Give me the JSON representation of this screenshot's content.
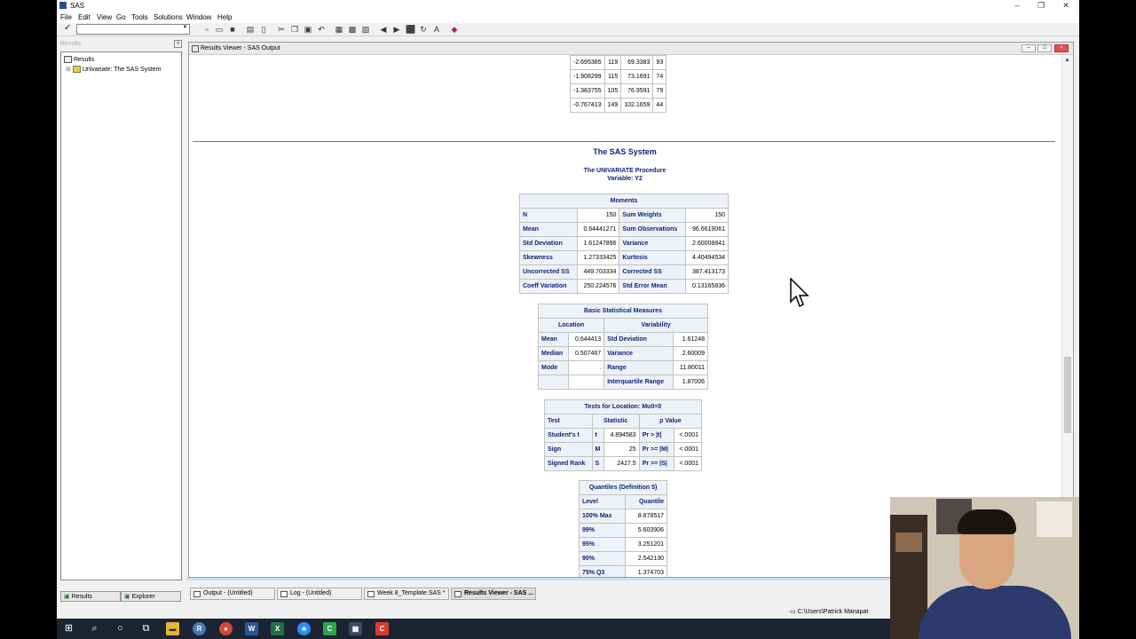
{
  "app": {
    "title": "SAS",
    "colors": {
      "header_text": "#112277",
      "header_bg": "#edf2f9"
    }
  },
  "menu": [
    "File",
    "Edit",
    "View",
    "Go",
    "Tools",
    "Solutions",
    "Window",
    "Help"
  ],
  "left_panel": {
    "header": "Results",
    "tree_root": "Results",
    "tree_child": "Univariate:  The SAS System",
    "tabs": [
      "Results",
      "Explorer"
    ]
  },
  "results_viewer": {
    "title": "Results Viewer - SAS Output"
  },
  "top_rows": [
    [
      "-2.695385",
      "119",
      "69.3383",
      "93"
    ],
    [
      "-1.908299",
      "115",
      "73.1691",
      "74"
    ],
    [
      "-1.383755",
      "105",
      "76.9591",
      "79"
    ],
    [
      "-0.767413",
      "149",
      "102.1659",
      "44"
    ]
  ],
  "report": {
    "title": "The SAS System",
    "procedure": "The UNIVARIATE Procedure",
    "variable": "Variable: Y2"
  },
  "moments": {
    "caption": "Moments",
    "rows": [
      [
        "N",
        "150",
        "Sum Weights",
        "150"
      ],
      [
        "Mean",
        "0.64441271",
        "Sum Observations",
        "96.6619061"
      ],
      [
        "Std Deviation",
        "1.61247896",
        "Variance",
        "2.60008841"
      ],
      [
        "Skewness",
        "1.27333425",
        "Kurtosis",
        "4.40494534"
      ],
      [
        "Uncorrected SS",
        "449.703334",
        "Corrected SS",
        "387.413173"
      ],
      [
        "Coeff Variation",
        "250.224576",
        "Std Error Mean",
        "0.13165836"
      ]
    ]
  },
  "basic_stats": {
    "caption": "Basic Statistical Measures",
    "location_header": "Location",
    "variability_header": "Variability",
    "rows": [
      [
        "Mean",
        "0.644413",
        "Std Deviation",
        "1.61248"
      ],
      [
        "Median",
        "0.507467",
        "Variance",
        "2.60009"
      ],
      [
        "Mode",
        ".",
        "Range",
        "11.80011"
      ],
      [
        "",
        "",
        "Interquartile Range",
        "1.87006"
      ]
    ]
  },
  "tests": {
    "caption": "Tests for Location: Mu0=0",
    "headers": [
      "Test",
      "Statistic",
      "p Value"
    ],
    "rows": [
      [
        "Student's t",
        "t",
        "4.894583",
        "Pr > |t|",
        "<.0001"
      ],
      [
        "Sign",
        "M",
        "25",
        "Pr >= |M|",
        "<.0001"
      ],
      [
        "Signed Rank",
        "S",
        "2427.5",
        "Pr >= |S|",
        "<.0001"
      ]
    ]
  },
  "quantiles": {
    "caption": "Quantiles (Definition 5)",
    "headers": [
      "Level",
      "Quantile"
    ],
    "rows": [
      [
        "100% Max",
        "8.878517"
      ],
      [
        "99%",
        "5.603906"
      ],
      [
        "95%",
        "3.251201"
      ],
      [
        "90%",
        "2.542130"
      ],
      [
        "75% Q3",
        "1.374703"
      ]
    ]
  },
  "window_tabs": [
    "Output - (Untitled)",
    "Log - (Untitled)",
    "Week 8_Template.SAS *",
    "Results Viewer - SAS ..."
  ],
  "status": {
    "path": "C:\\Users\\Patrick Manapat"
  },
  "taskbar_icons": [
    "windows-start-icon",
    "search-icon",
    "cortana-icon",
    "task-view-icon",
    "file-explorer-icon",
    "r-icon",
    "chrome-icon",
    "word-icon",
    "excel-icon",
    "zoom-icon",
    "camtasia-icon",
    "sas-icon",
    "recorder-icon"
  ]
}
